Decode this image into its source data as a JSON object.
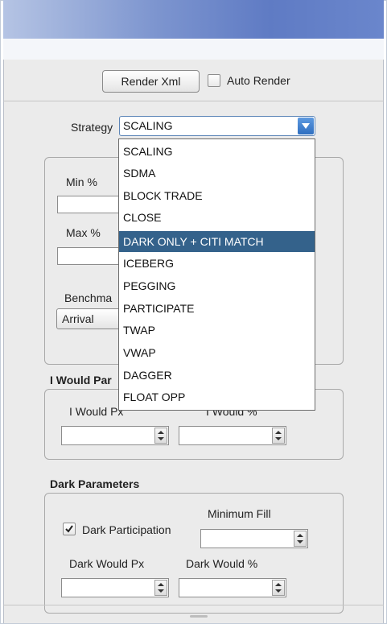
{
  "toolbar": {
    "render_label": "Render Xml",
    "auto_render_label": "Auto Render",
    "auto_render_checked": false
  },
  "strategy": {
    "label": "Strategy",
    "selected": "SCALING",
    "options": [
      "SCALING",
      "SDMA",
      "BLOCK TRADE",
      "CLOSE",
      "DARK ONLY + CITI MATCH",
      "ICEBERG",
      "PEGGING",
      "PARTICIPATE",
      "TWAP",
      "VWAP",
      "DAGGER",
      "FLOAT OPP"
    ],
    "highlighted_index": 4
  },
  "params": {
    "min_label": "Min %",
    "max_label": "Max %",
    "benchmark_label": "Benchma",
    "benchmark_value": "Arrival"
  },
  "i_would": {
    "section_title": "I Would Par",
    "px_label": "I Would Px",
    "pct_label": "I Would %"
  },
  "dark": {
    "section_title": "Dark Parameters",
    "participation_label": "Dark Participation",
    "participation_checked": true,
    "min_fill_label": "Minimum Fill",
    "would_px_label": "Dark Would Px",
    "would_pct_label": "Dark Would %"
  },
  "colors": {
    "title_gradient": "#6a86cc",
    "selection": "#34628b",
    "dropdown_button": "#3a7ad0"
  }
}
